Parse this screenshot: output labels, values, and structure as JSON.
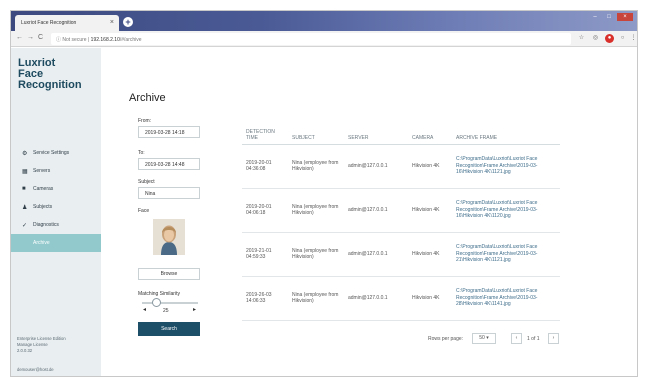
{
  "browser": {
    "tab_title": "Luxriot Face Recognition",
    "tab_close": "×",
    "new_tab": "+",
    "nav_back": "←",
    "nav_forward": "→",
    "nav_reload": "C",
    "address_security": "ⓘ Not secure",
    "address_host": "192.168.2.10",
    "address_path": "/#/archive",
    "win_min": "–",
    "win_max": "□",
    "win_close": "×"
  },
  "sidebar": {
    "logo_line1": "Luxriot",
    "logo_line2": "Face",
    "logo_line3": "Recognition",
    "items": [
      {
        "label": "Service Settings",
        "icon": "gear-icon",
        "glyph": "⚙"
      },
      {
        "label": "Servers",
        "icon": "server-icon",
        "glyph": "▦"
      },
      {
        "label": "Cameras",
        "icon": "camera-icon",
        "glyph": "■"
      },
      {
        "label": "Subjects",
        "icon": "users-icon",
        "glyph": "♟"
      },
      {
        "label": "Diagnostics",
        "icon": "diagnostics-icon",
        "glyph": "✓"
      },
      {
        "label": "Archive",
        "icon": "archive-icon",
        "glyph": ""
      }
    ],
    "active": "Archive",
    "license_line1": "Enterprise License Edition",
    "license_line2": "Manage License",
    "license_line3": "2.0.0.32",
    "version": "demouser@host.de"
  },
  "archive": {
    "title": "Archive",
    "from_label": "From:",
    "from_value": "2019-03-28 14:18",
    "to_label": "To:",
    "to_value": "2019-03-28 14:48",
    "subject_label": "Subject",
    "subject_value": "Nina",
    "face_label": "Face",
    "browse_label": "Browse",
    "similarity_label": "Matching Similarity",
    "similarity_value": "25",
    "similarity_fraction": 0.25,
    "step_minus": "◂",
    "step_plus": "▸",
    "search_label": "Search"
  },
  "table": {
    "columns": [
      "DETECTION TIME",
      "SUBJECT",
      "SERVER",
      "CAMERA",
      "ARCHIVE FRAME"
    ],
    "rows": [
      {
        "time": "2019-20-01 04:36:08",
        "subject": "Nina (employee from Hikvision)",
        "server": "admin@127.0.0.1",
        "camera": "Hikvision 4K",
        "frame": "C:\\ProgramData\\Luxriot\\Luxriot Face Recognition\\Frame Archive\\2019-03-16\\Hikvision 4K\\1121.jpg"
      },
      {
        "time": "2019-20-01 04:06:18",
        "subject": "Nina (employee from Hikvision)",
        "server": "admin@127.0.0.1",
        "camera": "Hikvision 4K",
        "frame": "C:\\ProgramData\\Luxriot\\Luxriot Face Recognition\\Frame Archive\\2019-03-16\\Hikvision 4K\\1120.jpg"
      },
      {
        "time": "2019-21-01 04:59:33",
        "subject": "Nina (employee from Hikvision)",
        "server": "admin@127.0.0.1",
        "camera": "Hikvision 4K",
        "frame": "C:\\ProgramData\\Luxriot\\Luxriot Face Recognition\\Frame Archive\\2019-03-21\\Hikvision 4K\\1121.jpg"
      },
      {
        "time": "2019-26-03 14:06:33",
        "subject": "Nina (employee from Hikvision)",
        "server": "admin@127.0.0.1",
        "camera": "Hikvision 4K",
        "frame": "C:\\ProgramData\\Luxriot\\Luxriot Face Recognition\\Frame Archive\\2019-03-28\\Hikvision 4K\\1141.jpg"
      }
    ]
  },
  "pager": {
    "rows_per_page_label": "Rows per page:",
    "rows_per_page_value": "50",
    "caret": "▾",
    "prev": "‹",
    "range": "1 of 1",
    "next": "›"
  }
}
